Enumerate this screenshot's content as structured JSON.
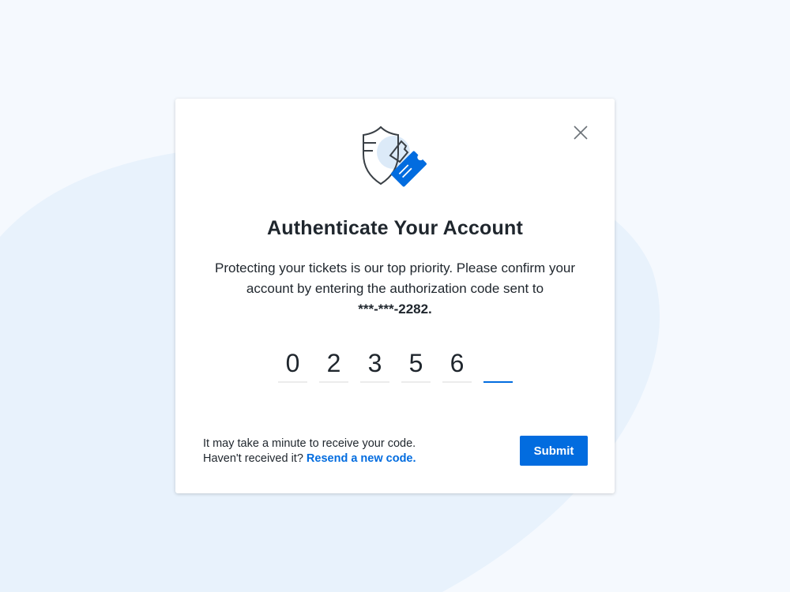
{
  "modal": {
    "title": "Authenticate Your Account",
    "description": "Protecting your tickets is our top priority. Please confirm your account by entering the authorization code sent to",
    "masked_phone": "***-***-2282.",
    "code_digits": [
      "0",
      "2",
      "3",
      "5",
      "6",
      ""
    ],
    "hint_line1": "It may take a minute to receive your code.",
    "hint_line2": "Haven't received it?",
    "resend_link": "Resend a new code.",
    "submit_label": "Submit",
    "icons": {
      "close": "close-icon",
      "hero": "shield-ticket-icon"
    }
  },
  "colors": {
    "accent": "#026cdf",
    "text": "#1f262d",
    "background": "#f5f9fe",
    "blob": "#e8f2fc"
  }
}
